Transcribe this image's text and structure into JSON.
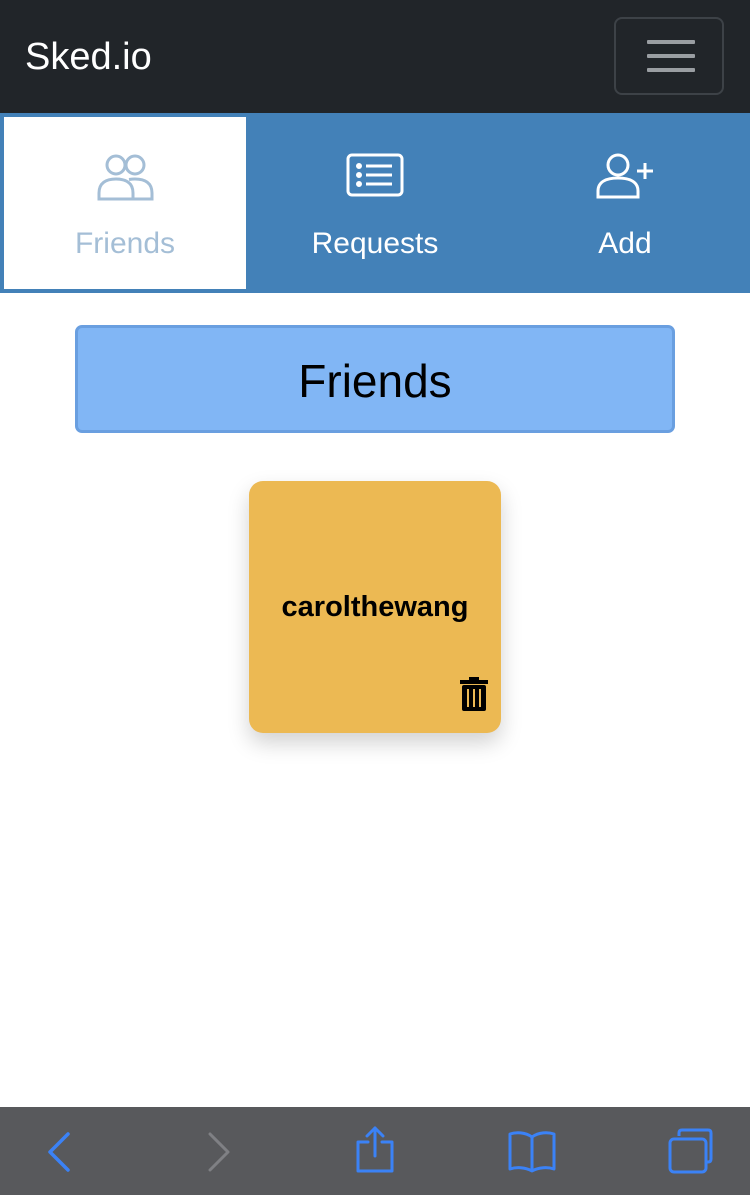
{
  "navbar": {
    "brand": "Sked.io",
    "menu_icon": "hamburger-menu-icon"
  },
  "tabs": [
    {
      "label": "Friends",
      "icon": "friends-icon",
      "active": true
    },
    {
      "label": "Requests",
      "icon": "list-icon",
      "active": false
    },
    {
      "label": "Add",
      "icon": "add-user-icon",
      "active": false
    }
  ],
  "main": {
    "heading": "Friends",
    "friends": [
      {
        "username": "carolthewang",
        "delete_icon": "trash-icon"
      }
    ]
  },
  "browser_toolbar": {
    "buttons": [
      "back-icon",
      "forward-icon",
      "share-icon",
      "bookmarks-icon",
      "tabs-icon"
    ]
  },
  "colors": {
    "navbar": "#212529",
    "tabbar": "#4381b8",
    "heading_box": "#81b6f5",
    "friend_card": "#ecb953",
    "toolbar": "#58595c",
    "toolbar_icon": "#3b82f6"
  }
}
